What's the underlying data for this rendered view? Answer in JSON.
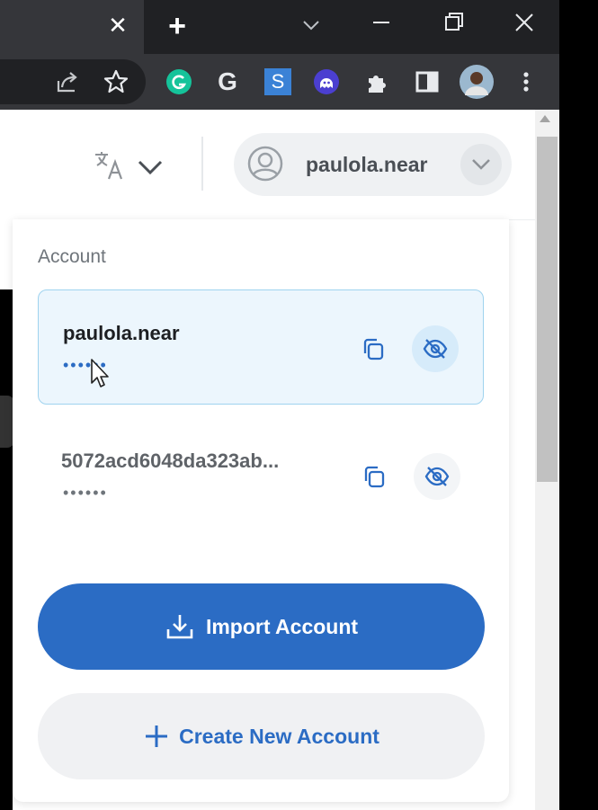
{
  "browser": {
    "tab_close_glyph": "✕",
    "new_tab_glyph": "+",
    "toolbar_icons": [
      "share-icon",
      "star-icon",
      "grammarly-extension-icon",
      "google-extension-icon",
      "s-extension-icon",
      "ghost-extension-icon",
      "extensions-puzzle-icon",
      "side-panel-icon",
      "profile-avatar",
      "more-menu-icon"
    ],
    "extension_letters": {
      "google": "G",
      "s": "S"
    }
  },
  "header": {
    "language_icon": "translate-icon",
    "account_pill_name": "paulola.near"
  },
  "dropdown": {
    "section_label": "Account",
    "accounts": [
      {
        "name": "paulola.near",
        "balance_masked": "••••••",
        "selected": true
      },
      {
        "name": "5072acd6048da323ab...",
        "balance_masked": "••••••",
        "selected": false
      }
    ],
    "import_label": "Import Account",
    "create_label": "Create New Account"
  },
  "colors": {
    "accent": "#2b6cc4",
    "selected_bg": "#ecf6fd",
    "selected_border": "#9fd3ef"
  }
}
